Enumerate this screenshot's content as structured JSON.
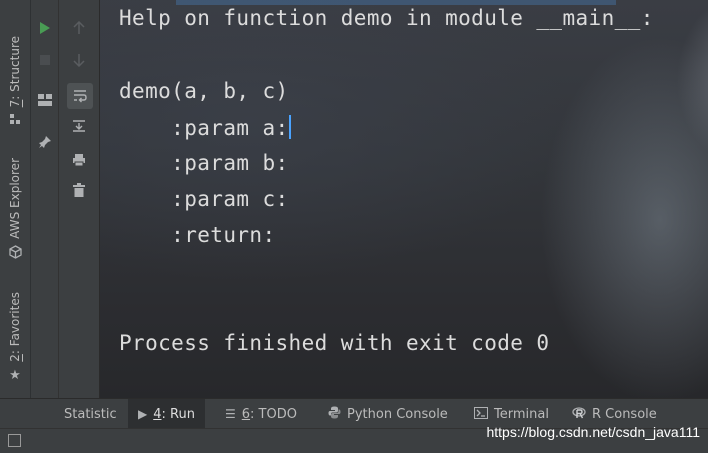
{
  "left_tool_strip": {
    "items": [
      {
        "label": "Structure",
        "mnemonic": "7",
        "icon": "structure-icon"
      },
      {
        "label": "AWS Explorer",
        "icon": "aws-cube-icon"
      },
      {
        "label": "Favorites",
        "mnemonic": "2",
        "icon": "star-icon"
      }
    ]
  },
  "run_toolbar": {
    "buttons": [
      "run-icon",
      "stop-icon",
      "up-arrow-icon",
      "down-arrow-icon",
      "layout-icon",
      "pin-icon",
      "soft-wrap-icon",
      "scroll-to-end-icon",
      "print-icon",
      "trash-icon"
    ],
    "run_color": "#499c54"
  },
  "console": {
    "lines": [
      "Help on function demo in module __main__:",
      "",
      "demo(a, b, c)",
      "    :param a:",
      "    :param b:",
      "    :param c:",
      "    :return:",
      "",
      "",
      "Process finished with exit code 0"
    ]
  },
  "bottom_tabs": [
    {
      "label": "Statistic",
      "icon": "statistic-icon"
    },
    {
      "mnemonic": "4",
      "label": ": Run",
      "icon": "run-tab-icon",
      "active": true
    },
    {
      "mnemonic": "6",
      "label": ": TODO",
      "icon": "todo-list-icon"
    },
    {
      "label": "Python Console",
      "icon": "python-icon"
    },
    {
      "label": "Terminal",
      "icon": "terminal-icon"
    },
    {
      "label": "R Console",
      "icon": "r-console-icon"
    }
  ],
  "status_bar": {
    "watermark": "https://blog.csdn.net/csdn_java111"
  }
}
